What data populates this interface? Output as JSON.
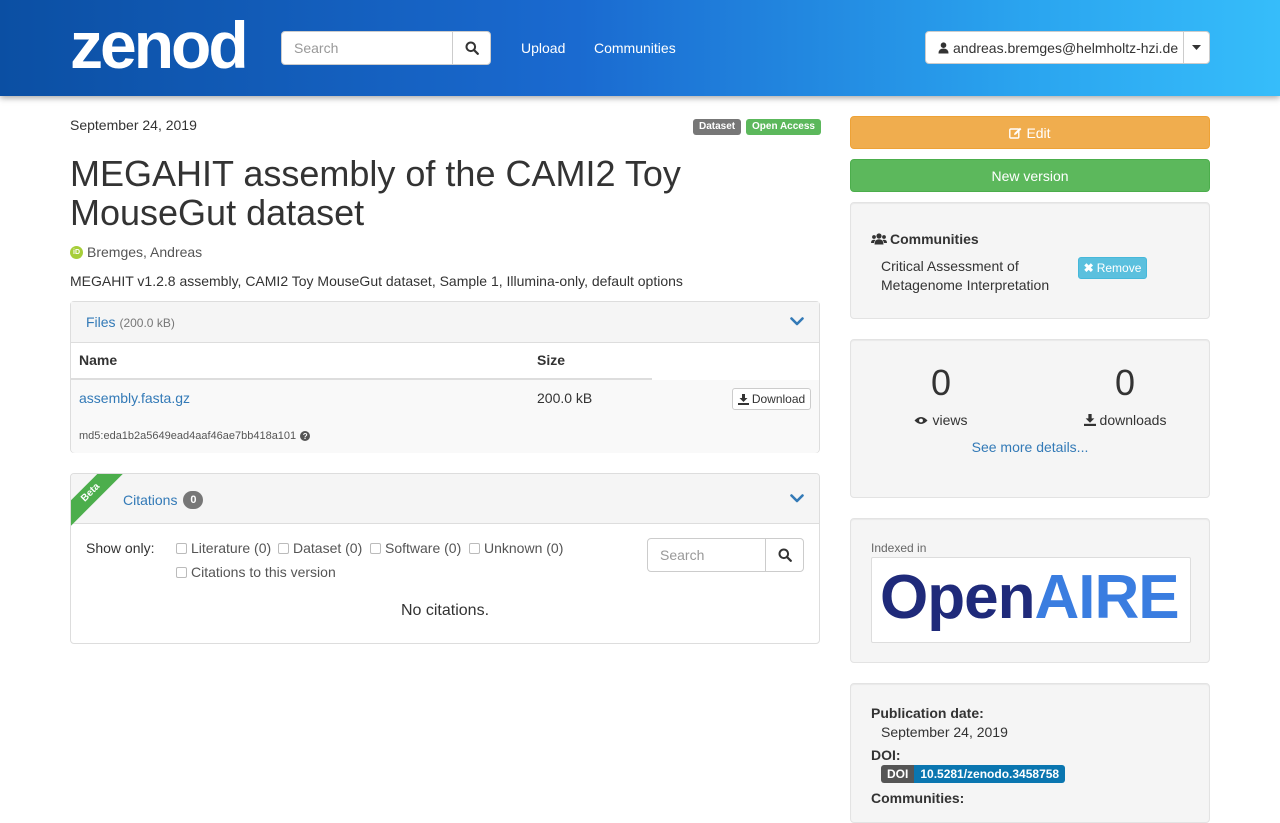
{
  "header": {
    "logo": "zenodo",
    "search_placeholder": "Search",
    "nav": [
      "Upload",
      "Communities"
    ],
    "user": "andreas.bremges@helmholtz-hzi.de"
  },
  "record": {
    "date": "September 24, 2019",
    "labels": [
      {
        "text": "Dataset",
        "color": "#777777"
      },
      {
        "text": "Open Access",
        "color": "#5cb85c"
      }
    ],
    "title": "MEGAHIT assembly of the CAMI2 Toy MouseGut dataset",
    "creator": "Bremges, Andreas",
    "description": "MEGAHIT v1.2.8 assembly, CAMI2 Toy MouseGut dataset, Sample 1, Illumina-only, default options"
  },
  "files": {
    "title": "Files",
    "size": "(200.0 kB)",
    "columns": [
      "Name",
      "Size"
    ],
    "rows": [
      {
        "name": "assembly.fasta.gz",
        "size": "200.0 kB",
        "download": "Download",
        "md5": "md5:eda1b2a5649ead4aaf46ae7bb418a101"
      }
    ]
  },
  "citations": {
    "ribbon": "Beta",
    "title": "Citations",
    "count": "0",
    "show_only": "Show only:",
    "filters": [
      "Literature (0)",
      "Dataset (0)",
      "Software (0)",
      "Unknown (0)",
      "Citations to this version"
    ],
    "search_placeholder": "Search",
    "empty": "No citations."
  },
  "sidebar": {
    "edit": "Edit",
    "new_version": "New version",
    "communities_title": "Communities",
    "community_name": "Critical Assessment of Metagenome Interpretation",
    "remove": "Remove",
    "views": {
      "count": "0",
      "label": "views"
    },
    "downloads": {
      "count": "0",
      "label": "downloads"
    },
    "see_more": "See more details...",
    "indexed_in": "Indexed in",
    "openaire": {
      "open": "Open",
      "aire": "AIRE"
    },
    "publication_date_label": "Publication date:",
    "publication_date": "September 24, 2019",
    "doi_label": "DOI:",
    "doi_badge_left": "DOI",
    "doi_badge_right": "10.5281/zenodo.3458758",
    "communities_label": "Communities:"
  },
  "colors": {
    "header_from": "#0b4fa3",
    "header_to": "#36bdfa",
    "link": "#337ab7",
    "edit": "#f0ad4e",
    "new_version": "#5cb85c",
    "remove": "#5bc0de",
    "openaire_dark": "#1f2a7a",
    "openaire_light": "#3a7de0"
  }
}
